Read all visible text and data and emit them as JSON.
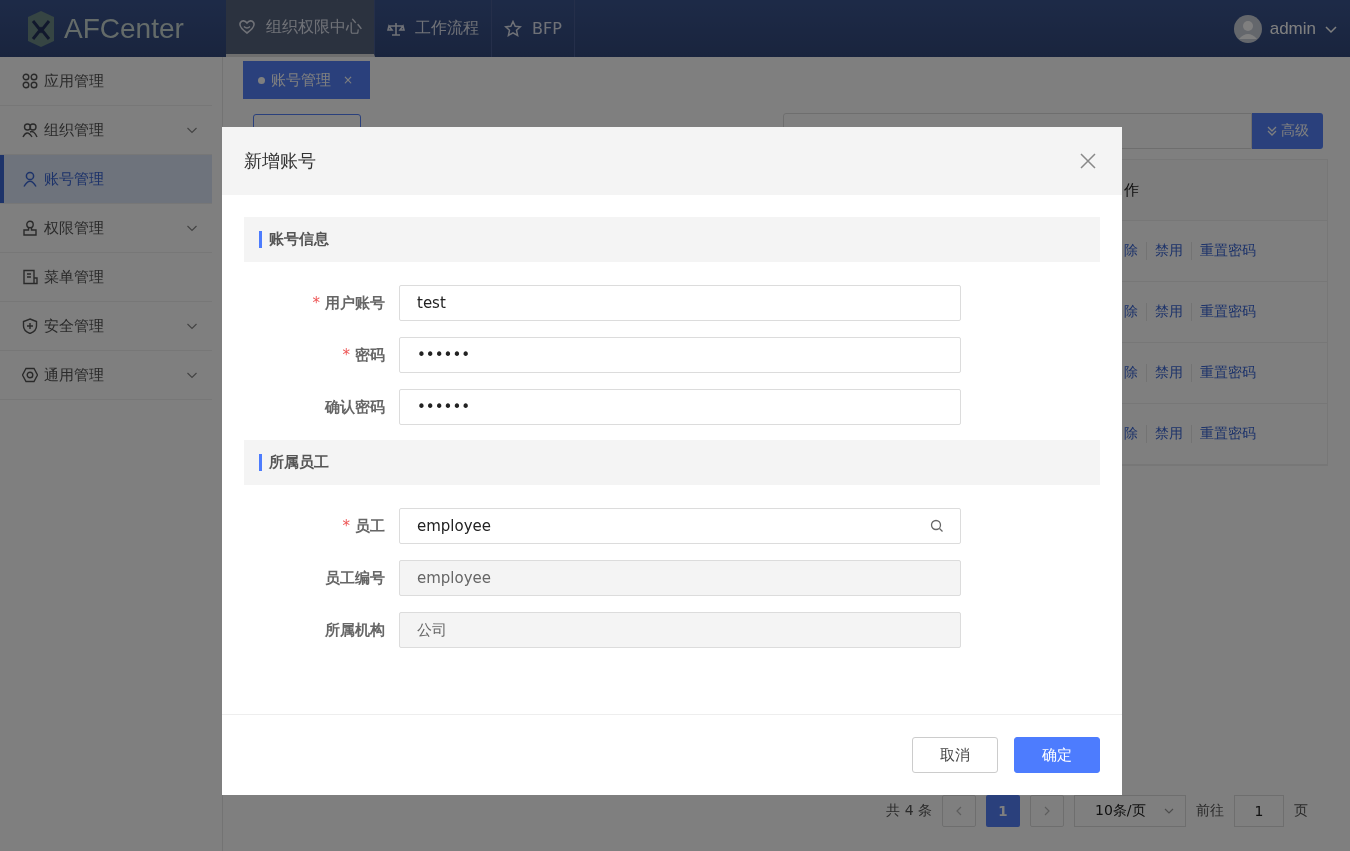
{
  "topbar": {
    "logo": "AFCenter",
    "tabs": [
      {
        "label": "组织权限中心",
        "selected": true
      },
      {
        "label": "工作流程",
        "selected": false
      },
      {
        "label": "BFP",
        "selected": false
      }
    ],
    "user": "admin"
  },
  "sidebar": {
    "items": [
      {
        "label": "应用管理",
        "selected": false,
        "expandable": false
      },
      {
        "label": "组织管理",
        "selected": false,
        "expandable": true
      },
      {
        "label": "账号管理",
        "selected": true,
        "expandable": false
      },
      {
        "label": "权限管理",
        "selected": false,
        "expandable": true
      },
      {
        "label": "菜单管理",
        "selected": false,
        "expandable": false
      },
      {
        "label": "安全管理",
        "selected": false,
        "expandable": true
      },
      {
        "label": "通用管理",
        "selected": false,
        "expandable": true
      }
    ]
  },
  "page_tabs": [
    {
      "label": "账号管理",
      "close": "×",
      "selected": true
    }
  ],
  "advanced_button": "高级",
  "table": {
    "header": "作",
    "rows": [
      {
        "actions": [
          "除",
          "禁用",
          "重置密码"
        ]
      },
      {
        "actions": [
          "除",
          "禁用",
          "重置密码"
        ]
      },
      {
        "actions": [
          "除",
          "禁用",
          "重置密码"
        ]
      },
      {
        "actions": [
          "除",
          "禁用",
          "重置密码"
        ]
      }
    ]
  },
  "pagination": {
    "total": "共 4 条",
    "pages": [
      {
        "label": "1",
        "selected": true
      }
    ],
    "page_size": "10条/页",
    "goto_label": "前往",
    "goto_value": "1",
    "goto_suffix": "页"
  },
  "dialog": {
    "title": "新增账号",
    "sections": [
      {
        "title": "账号信息",
        "fields": [
          {
            "label": "用户账号",
            "required_mark": "*",
            "value": "test",
            "kind": "text"
          },
          {
            "label": "密码",
            "required_mark": "*",
            "value": "••••••",
            "kind": "text"
          },
          {
            "label": "确认密码",
            "value": "••••••",
            "kind": "text"
          }
        ]
      },
      {
        "title": "所属员工",
        "fields": [
          {
            "label": "员工",
            "required_mark": "*",
            "value": "employee",
            "kind": "search"
          },
          {
            "label": "员工编号",
            "value": "employee",
            "kind": "readonly"
          },
          {
            "label": "所属机构",
            "value": "公司",
            "kind": "readonly"
          }
        ]
      }
    ],
    "buttons": [
      {
        "label": "取消",
        "kind": "secondary"
      },
      {
        "label": "确定",
        "kind": "primary"
      }
    ]
  }
}
